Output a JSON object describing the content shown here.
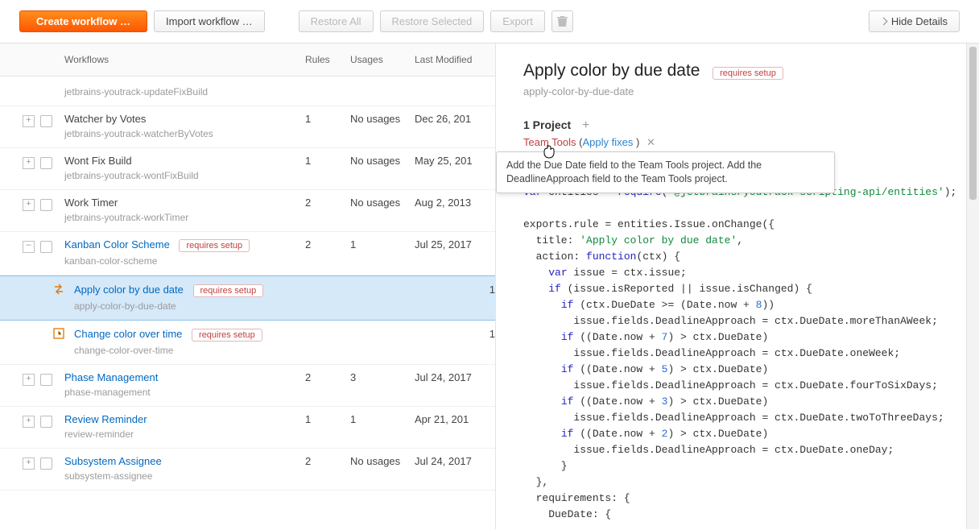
{
  "toolbar": {
    "create": "Create workflow …",
    "import": "Import workflow …",
    "restore_all": "Restore All",
    "restore_selected": "Restore Selected",
    "export": "Export",
    "hide_details": "Hide Details"
  },
  "columns": {
    "name": "Workflows",
    "rules": "Rules",
    "usages": "Usages",
    "last_modified": "Last Modified"
  },
  "usages_none": "No usages",
  "requires_setup": "requires setup",
  "workflows": [
    {
      "id": "jetbrains-youtrack-updateFixBuild"
    },
    {
      "name": "Watcher by Votes",
      "id": "jetbrains-youtrack-watcherByVotes",
      "rules": "1",
      "usages": "No usages",
      "mod": "Dec 26, 201"
    },
    {
      "name": "Wont Fix Build",
      "id": "jetbrains-youtrack-wontFixBuild",
      "rules": "1",
      "usages": "No usages",
      "mod": "May 25, 201"
    },
    {
      "name": "Work Timer",
      "id": "jetbrains-youtrack-workTimer",
      "rules": "2",
      "usages": "No usages",
      "mod": "Aug 2, 2013"
    },
    {
      "name": "Kanban Color Scheme",
      "id": "kanban-color-scheme",
      "rules": "2",
      "usages": "1",
      "mod": "Jul 25, 2017",
      "requires": true,
      "link": true,
      "expanded": true,
      "children": [
        {
          "name": "Apply color by due date",
          "id": "apply-color-by-due-date",
          "usages": "1",
          "requires": true,
          "selected": true,
          "icon": "swap"
        },
        {
          "name": "Change color over time",
          "id": "change-color-over-time",
          "usages": "1",
          "requires": true,
          "icon": "clock"
        }
      ]
    },
    {
      "name": "Phase Management",
      "id": "phase-management",
      "rules": "2",
      "usages": "3",
      "mod": "Jul 24, 2017",
      "link": true
    },
    {
      "name": "Review Reminder",
      "id": "review-reminder",
      "rules": "1",
      "usages": "1",
      "mod": "Apr 21, 201",
      "link": true
    },
    {
      "name": "Subsystem Assignee",
      "id": "subsystem-assignee",
      "rules": "2",
      "usages": "No usages",
      "mod": "Jul 24, 2017",
      "link": true
    }
  ],
  "detail": {
    "title": "Apply color by due date",
    "id": "apply-color-by-due-date",
    "project_count": "1 Project",
    "project": "Team Tools",
    "apply_fixes_open": "(",
    "apply_fixes": "Apply fixes",
    "apply_fixes_close": " )",
    "tooltip": "Add the Due Date field to the Team Tools project. Add the DeadlineApproach field to the Team Tools project."
  },
  "code": {
    "l1a": "var",
    "l1b": " entities = ",
    "l1c": "require",
    "l1d": "(",
    "l1e": "'@jetbrains/youtrack-scripting-api/entities'",
    "l1f": ");",
    "l2a": "exports.rule = entities.Issue.",
    "l2b": "onChange",
    "l2c": "({",
    "l3a": "  title: ",
    "l3b": "'Apply color by due date'",
    "l3c": ",",
    "l4a": "  action: ",
    "l4b": "function",
    "l4c": "(ctx) {",
    "l5a": "    ",
    "l5b": "var",
    "l5c": " issue = ctx.issue;",
    "l6a": "    ",
    "l6b": "if",
    "l6c": " (issue.isReported || issue.isChanged) {",
    "l7a": "      ",
    "l7b": "if",
    "l7c": " (ctx.DueDate >= (Date.now + ",
    "l7d": "8",
    "l7e": "))",
    "l8": "        issue.fields.DeadlineApproach = ctx.DueDate.moreThanAWeek;",
    "l9a": "      ",
    "l9b": "if",
    "l9c": " ((Date.now + ",
    "l9d": "7",
    "l9e": ") > ctx.DueDate)",
    "l10": "        issue.fields.DeadlineApproach = ctx.DueDate.oneWeek;",
    "l11a": "      ",
    "l11b": "if",
    "l11c": " ((Date.now + ",
    "l11d": "5",
    "l11e": ") > ctx.DueDate)",
    "l12": "        issue.fields.DeadlineApproach = ctx.DueDate.fourToSixDays;",
    "l13a": "      ",
    "l13b": "if",
    "l13c": " ((Date.now + ",
    "l13d": "3",
    "l13e": ") > ctx.DueDate)",
    "l14": "        issue.fields.DeadlineApproach = ctx.DueDate.twoToThreeDays;",
    "l15a": "      ",
    "l15b": "if",
    "l15c": " ((Date.now + ",
    "l15d": "2",
    "l15e": ") > ctx.DueDate)",
    "l16": "        issue.fields.DeadlineApproach = ctx.DueDate.oneDay;",
    "l17": "      }",
    "l18": "  },",
    "l19": "  requirements: {",
    "l20": "    DueDate: {"
  }
}
